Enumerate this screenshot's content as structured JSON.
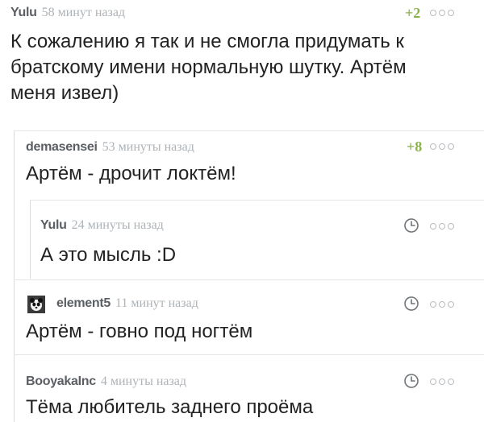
{
  "comments": [
    {
      "author": "Yulu",
      "time": "58 минут назад",
      "rating": "+2",
      "text_lines": [
        "К сожалению я так и не смогла придумать к",
        "братскому имени нормальную шутку. Артём",
        "меня извел)"
      ]
    },
    {
      "author": "demasensei",
      "time": "53 минуты назад",
      "rating": "+8",
      "text_lines": [
        "Артём - дрочит локтём!"
      ]
    },
    {
      "author": "Yulu",
      "time": "24 минуты назад",
      "text_lines": [
        "А это мысль :D"
      ]
    },
    {
      "author": "element5",
      "time": "11 минут назад",
      "text_lines": [
        "Артём - говно под ногтём"
      ]
    },
    {
      "author": "BooyakaInc",
      "time": "4 минуты назад",
      "text_lines": [
        "Тёма любитель заднего проёма"
      ]
    }
  ],
  "icons": {
    "more": "more-dots-icon",
    "clock": "clock-icon",
    "avatar": "avatar"
  },
  "colors": {
    "rating_positive": "#8ab24b",
    "author": "#5b5f63",
    "time": "#aeb3b7",
    "thread_line": "#d9dcdf"
  }
}
